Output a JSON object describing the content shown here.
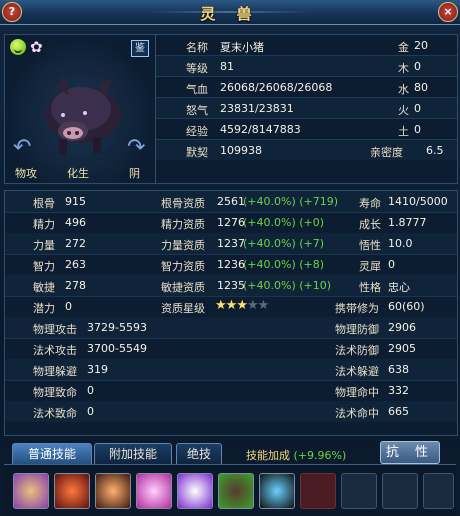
{
  "window": {
    "title": "灵  兽",
    "help_label": "?",
    "close_label": "×"
  },
  "portrait": {
    "jian_label": "鉴",
    "left_action": "物攻",
    "center_action": "化生",
    "right_action": "阴"
  },
  "info": {
    "name_label": "名称",
    "name_value": "夏末小猪",
    "level_label": "等级",
    "level_value": "81",
    "hp_label": "气血",
    "hp_value": "26068/26068/26068",
    "anger_label": "怒气",
    "anger_value": "23831/23831",
    "exp_label": "经验",
    "exp_value": "4592/8147883",
    "tacit_label": "默契",
    "tacit_value": "109938",
    "metal_label": "金",
    "metal_value": "20",
    "wood_label": "木",
    "wood_value": "0",
    "water_label": "水",
    "water_value": "80",
    "fire_label": "火",
    "fire_value": "0",
    "earth_label": "土",
    "earth_value": "0",
    "intimacy_label": "亲密度",
    "intimacy_value": "6.5"
  },
  "stats": [
    {
      "l1": "根骨",
      "v1": "915",
      "l2": "根骨资质",
      "v2": "2561",
      "b2": "(+40.0%) (+719)",
      "l3": "寿命",
      "v3": "1410/5000"
    },
    {
      "l1": "精力",
      "v1": "496",
      "l2": "精力资质",
      "v2": "1276",
      "b2": "(+40.0%) (+0)",
      "l3": "成长",
      "v3": "1.8777"
    },
    {
      "l1": "力量",
      "v1": "272",
      "l2": "力量资质",
      "v2": "1237",
      "b2": "(+40.0%) (+7)",
      "l3": "悟性",
      "v3": "10.0"
    },
    {
      "l1": "智力",
      "v1": "263",
      "l2": "智力资质",
      "v2": "1236",
      "b2": "(+40.0%) (+8)",
      "l3": "灵犀",
      "v3": "0"
    },
    {
      "l1": "敏捷",
      "v1": "278",
      "l2": "敏捷资质",
      "v2": "1235",
      "b2": "(+40.0%) (+10)",
      "l3": "性格",
      "v3": "忠心"
    }
  ],
  "potential": {
    "label": "潜力",
    "value": "0",
    "star_label": "资质星级",
    "stars_filled": 3,
    "stars_total": 5,
    "cultivation_label": "携带修为",
    "cultivation_value": "60(60)"
  },
  "combat": [
    {
      "l1": "物理攻击",
      "v1": "3729-5593",
      "l2": "物理防御",
      "v2": "2906"
    },
    {
      "l1": "法术攻击",
      "v1": "3700-5549",
      "l2": "法术防御",
      "v2": "2905"
    },
    {
      "l1": "物理躲避",
      "v1": "319",
      "l2": "法术躲避",
      "v2": "638"
    },
    {
      "l1": "物理致命",
      "v1": "0",
      "l2": "物理命中",
      "v2": "332"
    },
    {
      "l1": "法术致命",
      "v1": "0",
      "l2": "法术命中",
      "v2": "665"
    }
  ],
  "tabs": {
    "normal": "普通技能",
    "extra": "附加技能",
    "ultimate": "绝技"
  },
  "skill_bonus": {
    "label": "技能加成",
    "value": "(+9.96%)"
  },
  "resist_button": "抗 性",
  "skill_icons": [
    "swirl-skill-icon",
    "fire-ring-skill-icon",
    "beast-skill-icon",
    "pink-burst-skill-icon",
    "purple-flash-skill-icon",
    "green-beast-skill-icon",
    "dark-flame-skill-icon"
  ]
}
